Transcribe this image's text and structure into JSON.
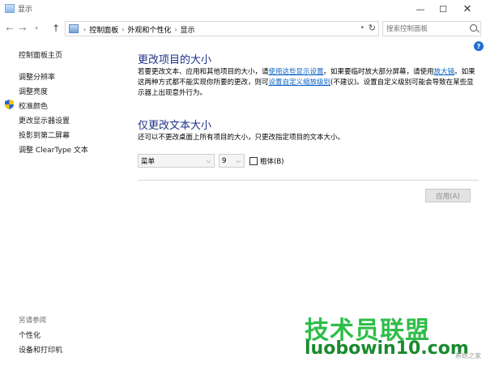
{
  "window": {
    "title": "显示",
    "minimize_glyph": "—",
    "maximize_glyph": "☐",
    "close_glyph": "✕"
  },
  "address_bar": {
    "breadcrumbs": [
      "控制面板",
      "外观和个性化",
      "显示"
    ],
    "search_placeholder": "搜索控制面板"
  },
  "sidebar": {
    "home": "控制面板主页",
    "items": [
      {
        "label": "调整分辨率"
      },
      {
        "label": "调整亮度"
      },
      {
        "label": "校准颜色"
      },
      {
        "label": "更改显示器设置"
      },
      {
        "label": "投影到第二屏幕"
      },
      {
        "label": "调整 ClearType 文本"
      }
    ],
    "see_also_heading": "另请参阅",
    "see_also": [
      {
        "label": "个性化"
      },
      {
        "label": "设备和打印机"
      }
    ]
  },
  "main": {
    "section1": {
      "title": "更改项目的大小",
      "p1_a": "若要更改文本、应用和其他项目的大小，请",
      "p1_link1": "使用这些显示设置",
      "p1_b": "。如果要临时放大部分屏幕，请使用",
      "p1_link2": "放大镜",
      "p1_c": "。如果这两种方式都不能实现你所要的更改，则可",
      "p1_link3": "设置自定义缩放级别",
      "p1_d": "(不建议)。设置自定义级别可能会导致在某些显示器上出现意外行为。"
    },
    "section2": {
      "title": "仅更改文本大小",
      "desc": "还可以不更改桌面上所有项目的大小，只更改指定项目的文本大小。",
      "item_select": "菜单",
      "size_select": "9",
      "bold_label": "粗体(B)",
      "bold_checked": false
    },
    "apply_label": "应用(A)"
  },
  "watermark": {
    "title": "技术员联盟",
    "url": "luobowin10.com",
    "logo_text": "系统之家"
  },
  "colors": {
    "heading": "#1e3287",
    "link": "#0b62c4",
    "help_icon": "#1f6fcf",
    "watermark_green": "#2fbd49"
  }
}
